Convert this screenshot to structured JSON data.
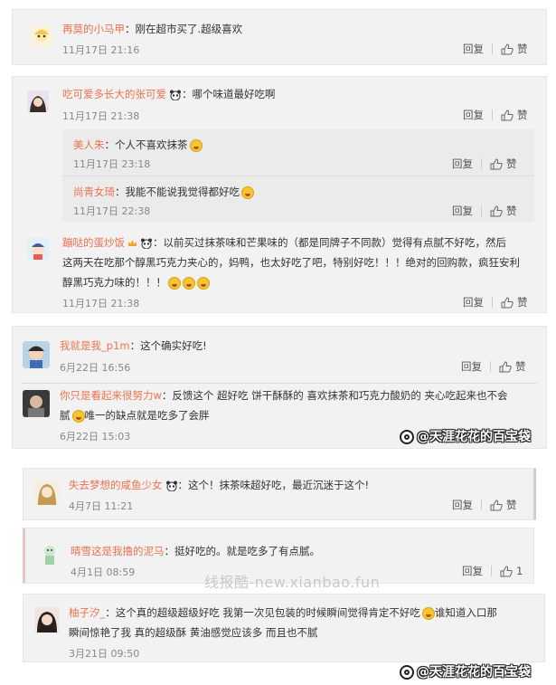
{
  "comments": [
    {
      "user": "再莫的小马甲",
      "text": "：刚在超市买了.超级喜欢",
      "time": "11月17日 21:16",
      "reply": "回复",
      "like": "赞"
    },
    {
      "user": "吃可爱多长大的张可爱",
      "text": "：哪个味道最好吃啊",
      "time": "11月17日 21:38",
      "reply": "回复",
      "like": "赞"
    },
    {
      "user": "美人朱",
      "text": "：个人不喜欢抹茶",
      "time": "11月17日 23:18",
      "reply": "回复",
      "like": "赞"
    },
    {
      "user": "尚青女琦",
      "text": "：我能不能说我觉得都好吃",
      "time": "11月17日 22:38",
      "reply": "回复",
      "like": "赞"
    },
    {
      "user": "蹦哒的蛋炒饭",
      "text1": "：以前买过抹茶味和芒果味的（都是同牌子不同款）觉得有点腻不好吃，然后",
      "text2": "这两天在吃那个醇黑巧克力夹心的，妈鸭，也太好吃了吧，特别好吃！！！绝对的回购款，疯狂安利",
      "text3": "醇黑巧克力味的！！！",
      "time": "11月17日 21:38",
      "reply": "回复",
      "like": "赞"
    },
    {
      "user": "我就是我_p1m",
      "text": "：这个确实好吃!",
      "time": "6月22日 16:56",
      "reply": "回复",
      "like": "赞"
    },
    {
      "user": "你只是看起来很努力w",
      "text1": "：反馈这个 超好吃 饼干酥酥的 喜欢抹茶和巧克力酸奶的 夹心吃起来也不会",
      "text2": "腻",
      "text3": "唯一的缺点就是吃多了会胖",
      "time": "6月22日 15:03"
    },
    {
      "user": "失去梦想的咸鱼少女",
      "text": "：这个！抹茶味超好吃，最近沉迷于这个!",
      "time": "4月7日 11:21",
      "reply": "回复",
      "like": "赞"
    },
    {
      "user": "晴雪这是我撸的泥马",
      "text": "：挺好吃的。就是吃多了有点腻。",
      "time": "4月1日 08:59",
      "reply": "回复",
      "like": "1"
    },
    {
      "user": "柚子汐_",
      "text1": "：这个真的超级超级好吃 我第一次见包装的时候瞬间觉得肯定不好吃",
      "text1b": "谁知道入口那",
      "text2": "瞬间惊艳了我 真的超级酥 黄油感觉应该多 而且也不腻",
      "time": "3月21日 09:50"
    }
  ],
  "watermarks": {
    "tag1": "@天涯花花的百宝袋",
    "tag2": "@天涯花花的百宝袋",
    "site": "线报酷-new.xianbao.fun"
  },
  "icons": [
    "thumbs-up-icon",
    "grinning-emoji-icon",
    "panda-icon",
    "crown-icon"
  ]
}
